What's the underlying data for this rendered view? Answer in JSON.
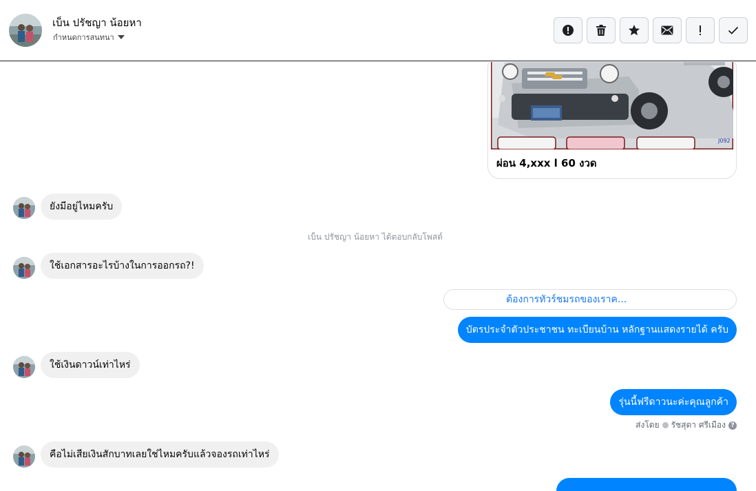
{
  "header": {
    "contact_name": "เบ็น ปรัชญา น้อยหา",
    "settings_label": "กำหนดการสนทนา",
    "actions": [
      {
        "name": "mark-spam-button",
        "icon": "exclamation-circle-icon"
      },
      {
        "name": "delete-button",
        "icon": "trash-icon"
      },
      {
        "name": "star-button",
        "icon": "star-icon"
      },
      {
        "name": "mark-unread-button",
        "icon": "envelope-icon"
      },
      {
        "name": "follow-up-button",
        "icon": "exclamation-icon"
      },
      {
        "name": "mark-done-button",
        "icon": "check-icon"
      }
    ]
  },
  "thread": {
    "post_card": {
      "caption": "ผ่อน 4,xxx l 60 งวด"
    },
    "msg1": "ยังมีอยู่ไหมครับ",
    "system_note": "เบ็น ปรัชญา น้อยหา ได้ตอบกลับโพสต์",
    "msg2": "ใช้เอกสารอะไรบ้างในการออกรถ?!",
    "reply_quote": "ต้องการทัวร์ชมรถของเราค...",
    "reply1": "บัตรประจำตัวประชาชน ทะเบียนบ้าน หลักฐานแสดงรายได้ ครับ",
    "msg3": "ใช้เงินดาวน์เท่าไหร่",
    "reply2": "รุ่นนี้ฟรีดาวนะค่ะคุณลูกค้า",
    "sent_by_label": "ส่งโดย",
    "sent_by_name": "รัชสุดา ศรีเมือง",
    "msg4": "คือไม่เสียเงินสักบาทเลยใช่ไหมครับแล้วจองรถเท่าไหร่"
  },
  "colors": {
    "outgoing_bubble": "#0084ff",
    "incoming_bubble": "#f0f0f0",
    "link": "#1877f2"
  }
}
